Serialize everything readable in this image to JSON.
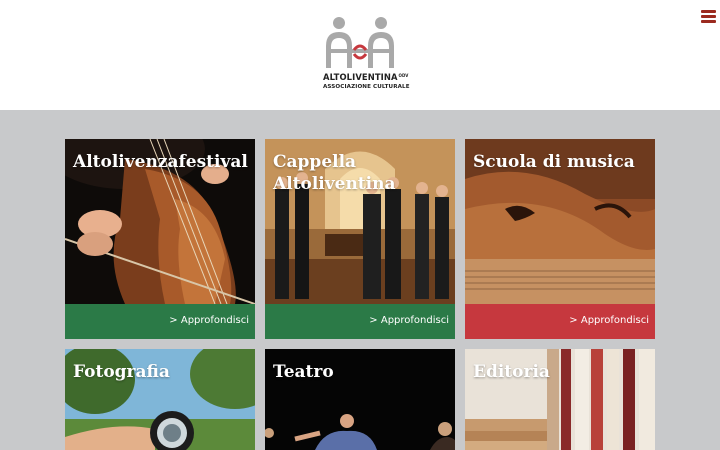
{
  "header": {
    "logo_name": "ALTOLIVENTINA",
    "logo_odv": "ODV",
    "logo_subtitle": "ASSOCIAZIONE CULTURALE",
    "menu_icon": "hamburger-menu-icon"
  },
  "colors": {
    "green": "#2b7a47",
    "red": "#c6383e",
    "menu": "#9b2a1f",
    "background": "#c8c9cb"
  },
  "cards": [
    {
      "title": "Altolivenzafestival",
      "link": "> Approfondisci",
      "footer_color": "#2b7a47"
    },
    {
      "title": "Cappella Altoliventina",
      "link": "> Approfondisci",
      "footer_color": "#2b7a47"
    },
    {
      "title": "Scuola di musica",
      "link": "> Approfondisci",
      "footer_color": "#c6383e"
    },
    {
      "title": "Fotografia",
      "link": "",
      "footer_color": ""
    },
    {
      "title": "Teatro",
      "link": "",
      "footer_color": ""
    },
    {
      "title": "Editoria",
      "link": "",
      "footer_color": ""
    }
  ]
}
